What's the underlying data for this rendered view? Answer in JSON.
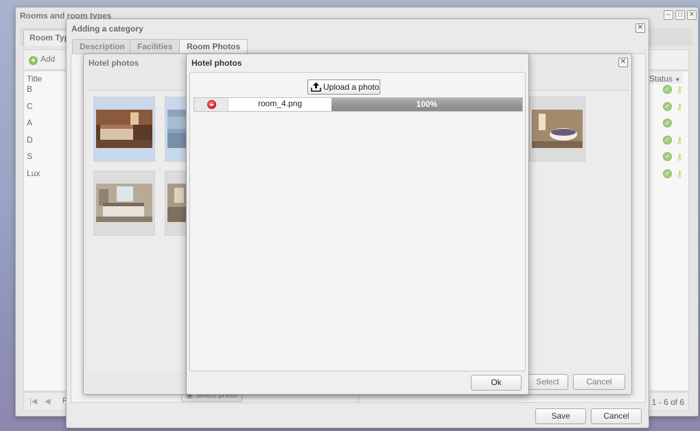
{
  "rooms_window": {
    "title": "Rooms and room types",
    "tab": "Room Typ",
    "add_label": "Add",
    "columns": {
      "title": "Title",
      "status": "Status"
    },
    "rows": [
      "B",
      "C",
      "A",
      "D",
      "S",
      "Lux"
    ],
    "row_has_key": [
      true,
      true,
      false,
      true,
      true,
      true
    ],
    "pager_left": "P",
    "pager_info": "ng 1 - 6 of 6"
  },
  "category_window": {
    "title": "Adding a category",
    "tabs": [
      "Description",
      "Facilities",
      "Room Photos"
    ],
    "active_tab": "Room Photos",
    "select_photo_label": "Select photo",
    "save_label": "Save",
    "cancel_label": "Cancel"
  },
  "gallery_window": {
    "title": "Hotel photos",
    "select_label": "Select",
    "cancel_label": "Cancel"
  },
  "upload_window": {
    "title": "Hotel photos",
    "upload_label": "Upload a photo",
    "file_name": "room_4.png",
    "progress_text": "100%",
    "progress_fraction": 1.0,
    "ok_label": "Ok"
  },
  "colors": {
    "progress": "#9a9a9a",
    "status_ok": "#7fbf4d",
    "key": "#d8b020",
    "remove": "#d22222"
  }
}
